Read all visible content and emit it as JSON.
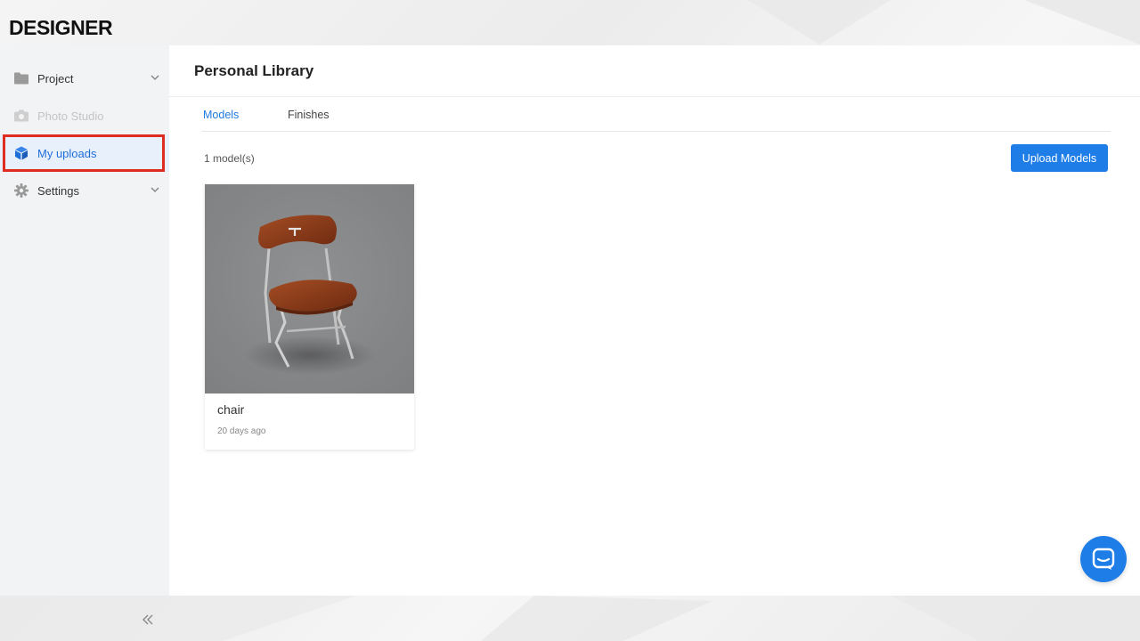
{
  "app": {
    "logo_text": "DESIGNER"
  },
  "sidebar": {
    "items": [
      {
        "label": "Project",
        "icon": "folder-icon",
        "state": "normal",
        "expandable": true
      },
      {
        "label": "Photo Studio",
        "icon": "camera-icon",
        "state": "disabled",
        "expandable": false
      },
      {
        "label": "My uploads",
        "icon": "cube-icon",
        "state": "active",
        "expandable": false
      },
      {
        "label": "Settings",
        "icon": "gear-icon",
        "state": "normal",
        "expandable": true
      }
    ],
    "collapse_icon": "double-chevron-left-icon"
  },
  "main": {
    "title": "Personal Library",
    "tabs": [
      {
        "label": "Models",
        "active": true
      },
      {
        "label": "Finishes",
        "active": false
      }
    ],
    "count_text": "1 model(s)",
    "upload_button": "Upload Models",
    "models": [
      {
        "name": "chair",
        "date": "20 days ago"
      }
    ]
  },
  "chat": {
    "icon": "chat-icon"
  },
  "colors": {
    "accent": "#1e7de6",
    "active_text": "#1f6fd9",
    "active_bg": "#e8f0fc",
    "highlight": "#e02b20"
  }
}
